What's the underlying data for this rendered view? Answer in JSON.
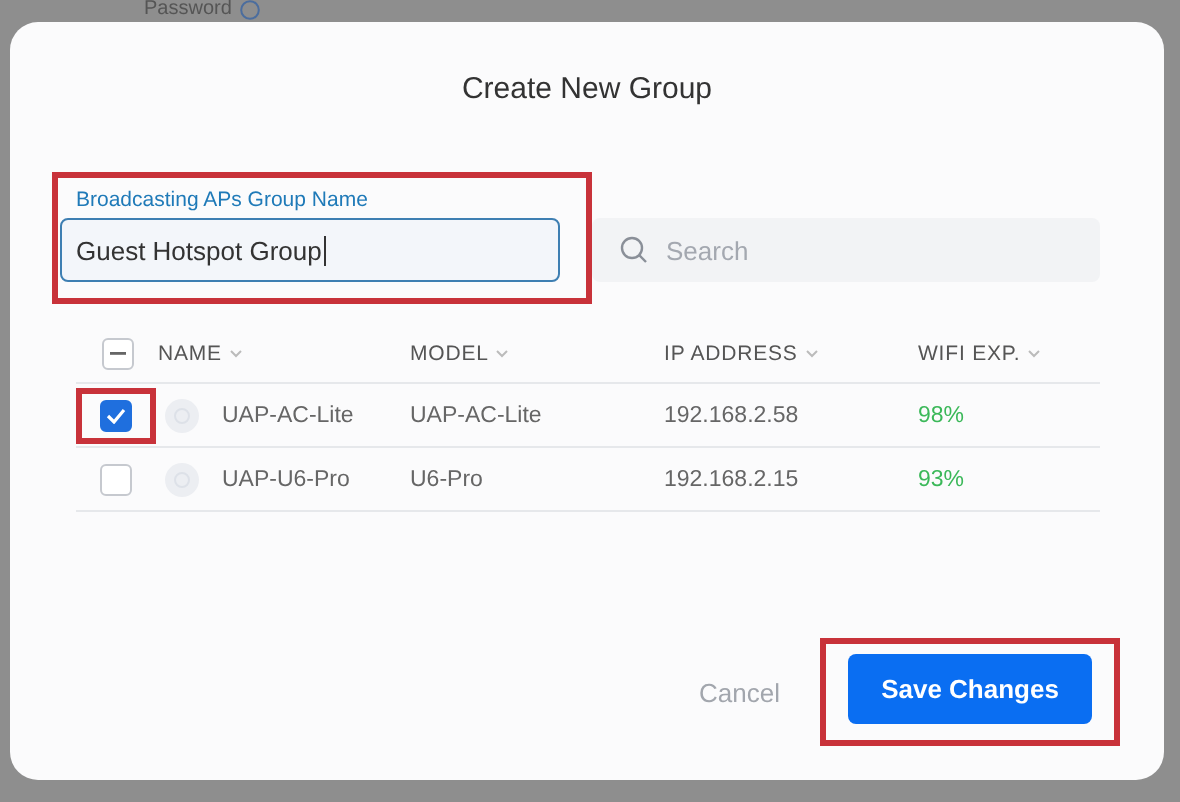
{
  "background": {
    "label": "Password"
  },
  "dialog": {
    "title": "Create New Group",
    "name_field": {
      "label": "Broadcasting APs Group Name",
      "value": "Guest Hotspot Group",
      "highlighted": true
    },
    "search": {
      "placeholder": "Search"
    },
    "table": {
      "select_all": {
        "indeterminate": true
      },
      "columns": [
        {
          "label": "NAME"
        },
        {
          "label": "MODEL"
        },
        {
          "label": "IP ADDRESS"
        },
        {
          "label": "WIFI EXP."
        }
      ],
      "rows": [
        {
          "checked": true,
          "highlighted": true,
          "name": "UAP-AC-Lite",
          "model": "UAP-AC-Lite",
          "ip_address": "192.168.2.58",
          "wifi_exp": "98%"
        },
        {
          "checked": false,
          "highlighted": false,
          "name": "UAP-U6-Pro",
          "model": "U6-Pro",
          "ip_address": "192.168.2.15",
          "wifi_exp": "93%"
        }
      ]
    },
    "buttons": [
      {
        "label": "Cancel",
        "kind": "secondary",
        "highlighted": false
      },
      {
        "label": "Save Changes",
        "kind": "primary",
        "highlighted": true
      }
    ]
  }
}
